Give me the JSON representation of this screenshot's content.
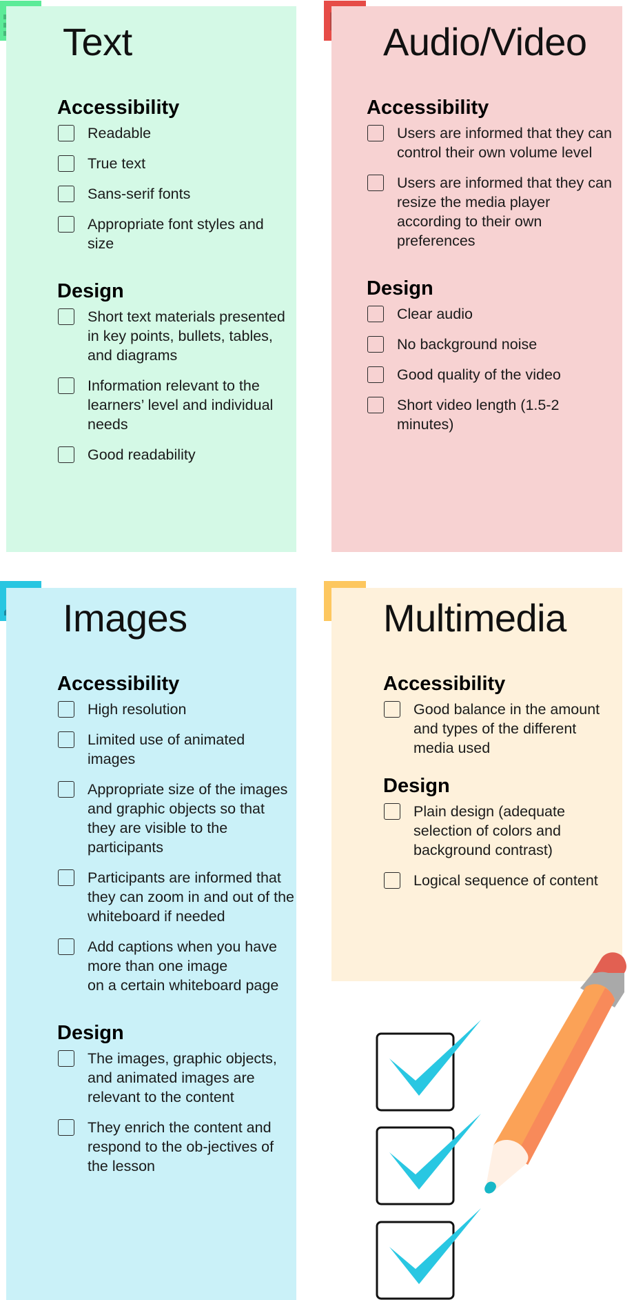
{
  "panels": {
    "text": {
      "title": "Text",
      "icon": "text-lines-icon",
      "color": "#d4f9e6",
      "icon_color": "#5ceb98",
      "accessibility_heading": "Accessibility",
      "accessibility": [
        "Readable",
        "True text",
        "Sans-serif fonts",
        "Appropriate font styles and size"
      ],
      "design_heading": "Design",
      "design": [
        "Short text materials presented in key points, bullets, tables, and diagrams",
        "Information relevant to the learners’ level and individual needs",
        "Good readability"
      ]
    },
    "audio_video": {
      "title": "Audio/Video",
      "icon": "video-camera-icon",
      "color": "#f7d2d2",
      "icon_color": "#e64c47",
      "accessibility_heading": "Accessibility",
      "accessibility": [
        "Users are informed that they can control their own volume level",
        "Users are informed that they can resize the media player according to their own preferences"
      ],
      "design_heading": "Design",
      "design": [
        "Clear audio",
        "No background noise",
        "Good quality of the video",
        "Short video length (1.5-2 minutes)"
      ]
    },
    "images": {
      "title": "Images",
      "icon": "landscape-image-icon",
      "color": "#caf1f8",
      "icon_color": "#28c6e1",
      "accessibility_heading": "Accessibility",
      "accessibility": [
        "High resolution",
        "Limited use of animated images",
        "Appropriate size of the images and graphic objects so that they are visible to the participants",
        "Participants are informed that they can zoom in and out of the whiteboard if needed",
        "Add captions when you have more than one image\non a certain whiteboard page"
      ],
      "design_heading": "Design",
      "design": [
        "The images, graphic objects, and animated images are relevant to the content",
        "They enrich the content and respond to the ob-jectives of the lesson"
      ]
    },
    "multimedia": {
      "title": "Multimedia",
      "icon": "play-icon",
      "color": "#fef1db",
      "icon_color": "#fdc75f",
      "accessibility_heading": "Accessibility",
      "accessibility": [
        "Good balance in the amount and types of the different media used"
      ],
      "design_heading": "Design",
      "design": [
        "Plain design (adequate selection of colors and background contrast)",
        "Logical sequence of content"
      ]
    }
  },
  "illustration": {
    "checked_boxes": 3,
    "check_color": "#29c7e2",
    "pencil_body_color": "#fba257",
    "pencil_shade_color": "#f88a5a",
    "eraser_color": "#e26052",
    "ferrule_color": "#a9a9a9",
    "pencil_tip_color": "#17b7c7"
  }
}
